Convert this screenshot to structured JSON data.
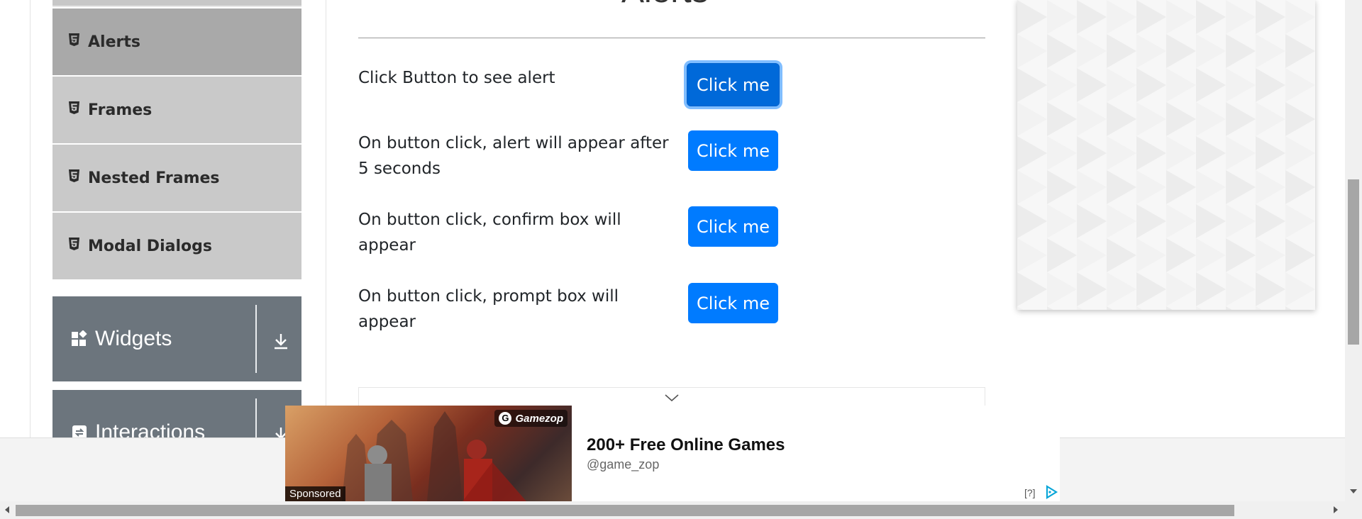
{
  "sidebar": {
    "items": [
      {
        "label": "Alerts",
        "icon": "html5-icon",
        "active": true
      },
      {
        "label": "Frames",
        "icon": "html5-icon",
        "active": false
      },
      {
        "label": "Nested Frames",
        "icon": "html5-icon",
        "active": false
      },
      {
        "label": "Modal Dialogs",
        "icon": "html5-icon",
        "active": false
      }
    ],
    "groups": [
      {
        "label": "Widgets",
        "icon": "widgets-icon",
        "toggle_icon": "download-arrow-icon"
      },
      {
        "label": "Interactions",
        "icon": "interactions-icon",
        "toggle_icon": "download-arrow-icon"
      }
    ]
  },
  "main": {
    "heading": "Alerts",
    "rows": [
      {
        "text": "Click Button to see alert",
        "button_label": "Click me"
      },
      {
        "text": "On button click, alert will appear after 5 seconds",
        "button_label": "Click me"
      },
      {
        "text": "On button click, confirm box will appear",
        "button_label": "Click me"
      },
      {
        "text": "On button click, prompt box will appear",
        "button_label": "Click me"
      }
    ]
  },
  "ad": {
    "title": "200+ Free Online Games",
    "handle": "@game_zop",
    "brand": "Gamezop",
    "sponsored": "Sponsored",
    "help": "[?]"
  },
  "colors": {
    "primary": "#007bff",
    "sidebar_item": "#c9c9c9",
    "sidebar_active": "#a9a9a9",
    "group_header": "#6c757d"
  }
}
